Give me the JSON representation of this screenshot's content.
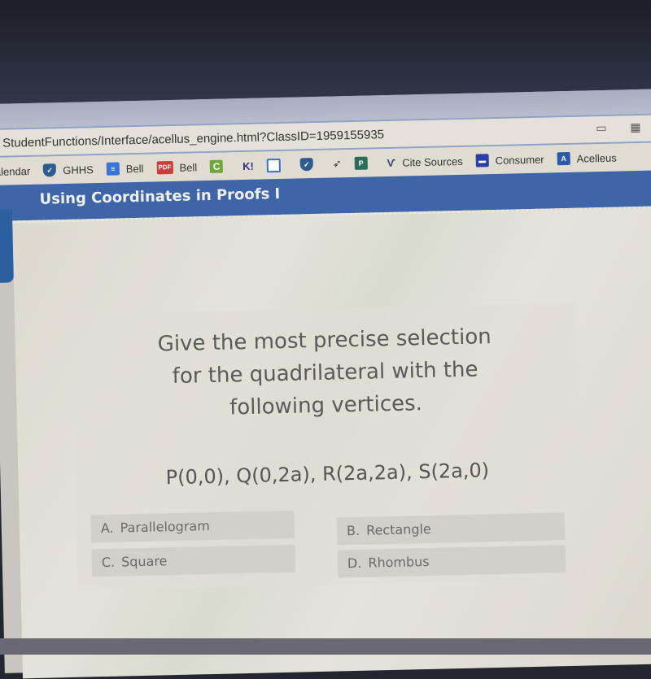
{
  "browser": {
    "url": "StudentFunctions/Interface/acellus_engine.html?ClassID=1959155935",
    "address_icons": [
      "cast-icon",
      "extensions-icon"
    ],
    "bookmarks": [
      {
        "label": "alendar",
        "icon": "calendar-icon",
        "color": ""
      },
      {
        "label": "GHHS",
        "icon": "shield-icon",
        "color": "#2f5c8f"
      },
      {
        "label": "Bell",
        "icon": "docs-icon",
        "color": "#3b74d9"
      },
      {
        "label": "Bell",
        "icon": "pdf-icon",
        "color": "#c9403a"
      },
      {
        "label": "",
        "icon": "c-icon",
        "color": "#6ea83c"
      },
      {
        "label": "K!",
        "icon": "kahoot-icon",
        "color": ""
      },
      {
        "label": "",
        "icon": "layout-icon",
        "color": "#3b6fd1"
      },
      {
        "label": "",
        "icon": "shield-icon",
        "color": "#2f5c8f"
      },
      {
        "label": "",
        "icon": "bird-icon",
        "color": ""
      },
      {
        "label": "",
        "icon": "p-icon",
        "color": "#2e6b5a"
      },
      {
        "label": "Cite Sources",
        "icon": "squirrel-icon",
        "color": ""
      },
      {
        "label": "Consumer",
        "icon": "window-icon",
        "color": "#2b3fa8"
      },
      {
        "label": "Acelleus",
        "icon": "acellus-icon",
        "color": "#2b5aa8"
      }
    ]
  },
  "lesson": {
    "title": "Using Coordinates in Proofs I"
  },
  "question": {
    "prompt_lines": [
      "Give the most precise selection",
      "for the quadrilateral with the",
      "following vertices."
    ],
    "vertices": "P(0,0), Q(0,2a), R(2a,2a), S(2a,0)",
    "answers": [
      {
        "letter": "A.",
        "text": "Parallelogram"
      },
      {
        "letter": "B.",
        "text": "Rectangle"
      },
      {
        "letter": "C.",
        "text": "Square"
      },
      {
        "letter": "D.",
        "text": "Rhombus"
      }
    ]
  }
}
